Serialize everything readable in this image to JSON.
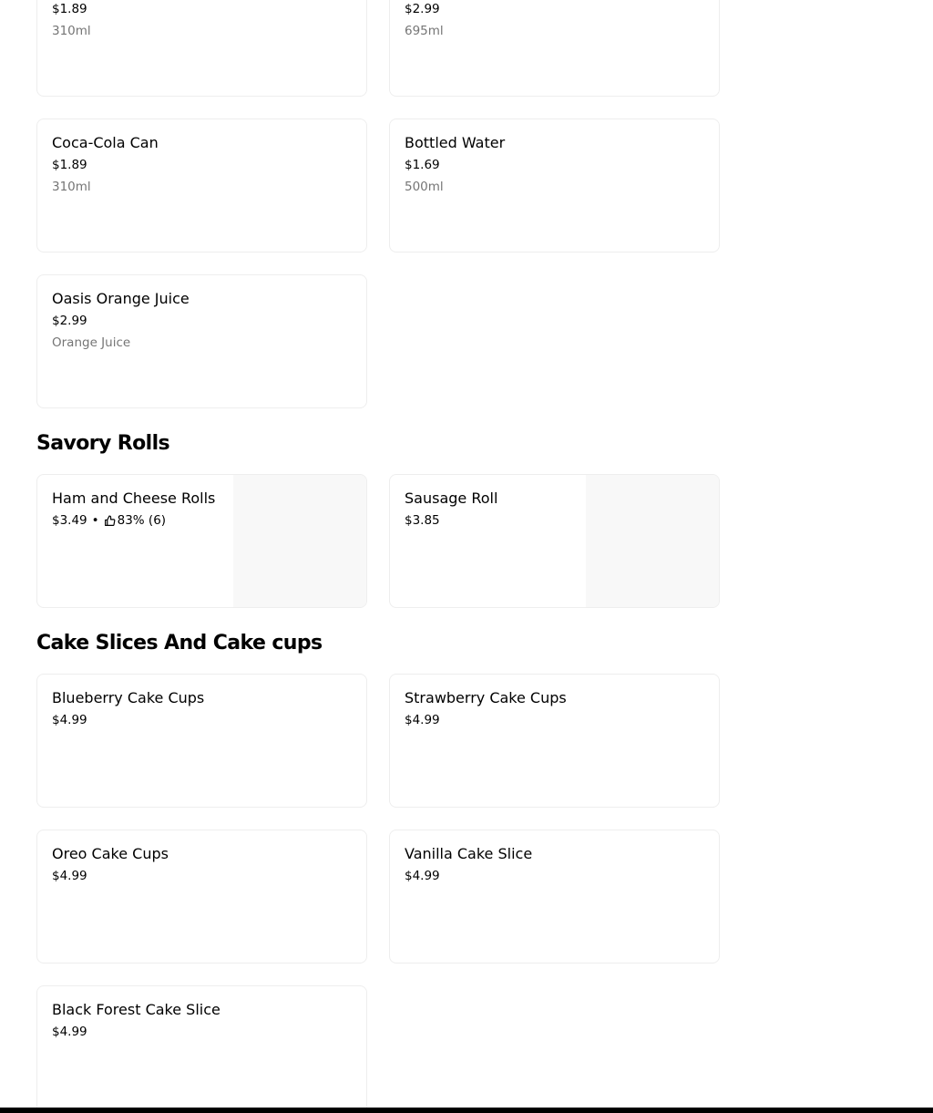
{
  "drinks_partial": [
    {
      "price": "$1.89",
      "desc": "310ml"
    },
    {
      "price": "$2.99",
      "desc": "695ml"
    }
  ],
  "drinks": [
    {
      "title": "Coca-Cola Can",
      "price": "$1.89",
      "desc": "310ml"
    },
    {
      "title": "Bottled Water",
      "price": "$1.69",
      "desc": "500ml"
    },
    {
      "title": "Oasis Orange Juice",
      "price": "$2.99",
      "desc": "Orange Juice"
    }
  ],
  "savory": {
    "heading": "Savory Rolls",
    "items": [
      {
        "title": "Ham and Cheese Rolls",
        "price": "$3.49",
        "separator": "•",
        "rating": "83% (6)",
        "rating_icon": "thumbs-up-icon"
      },
      {
        "title": "Sausage Roll",
        "price": "$3.85"
      }
    ]
  },
  "cakes": {
    "heading": "Cake Slices And Cake cups",
    "items": [
      {
        "title": "Blueberry Cake Cups",
        "price": "$4.99"
      },
      {
        "title": "Strawberry Cake Cups",
        "price": "$4.99"
      },
      {
        "title": "Oreo Cake Cups",
        "price": "$4.99"
      },
      {
        "title": "Vanilla Cake Slice",
        "price": "$4.99"
      },
      {
        "title": "Black Forest Cake Slice",
        "price": "$4.99"
      }
    ]
  },
  "colors": {
    "text": "#000000",
    "muted_text": "#757575",
    "card_border": "#eeeeee",
    "thumbnail_bg": "#f8f8f8",
    "bottom_bar": "#000000"
  }
}
